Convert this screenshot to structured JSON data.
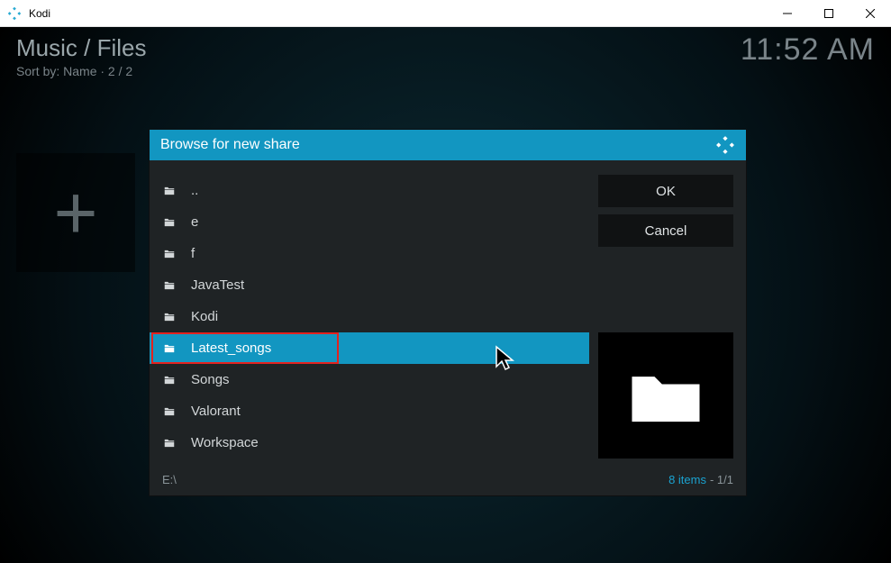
{
  "window": {
    "app_name": "Kodi"
  },
  "header": {
    "breadcrumb": "Music / Files",
    "sort_info": "Sort by: Name  ·  2 / 2",
    "clock": "11:52 AM"
  },
  "dialog": {
    "title": "Browse for new share",
    "ok_label": "OK",
    "cancel_label": "Cancel",
    "items": [
      {
        "label": ".."
      },
      {
        "label": "e"
      },
      {
        "label": "f"
      },
      {
        "label": "JavaTest"
      },
      {
        "label": "Kodi"
      },
      {
        "label": "Latest_songs"
      },
      {
        "label": "Songs"
      },
      {
        "label": "Valorant"
      },
      {
        "label": "Workspace"
      }
    ],
    "selected_index": 5,
    "highlight_index": 5,
    "footer_path": "E:\\",
    "footer_items": "8 items",
    "footer_page": " - 1/1"
  }
}
